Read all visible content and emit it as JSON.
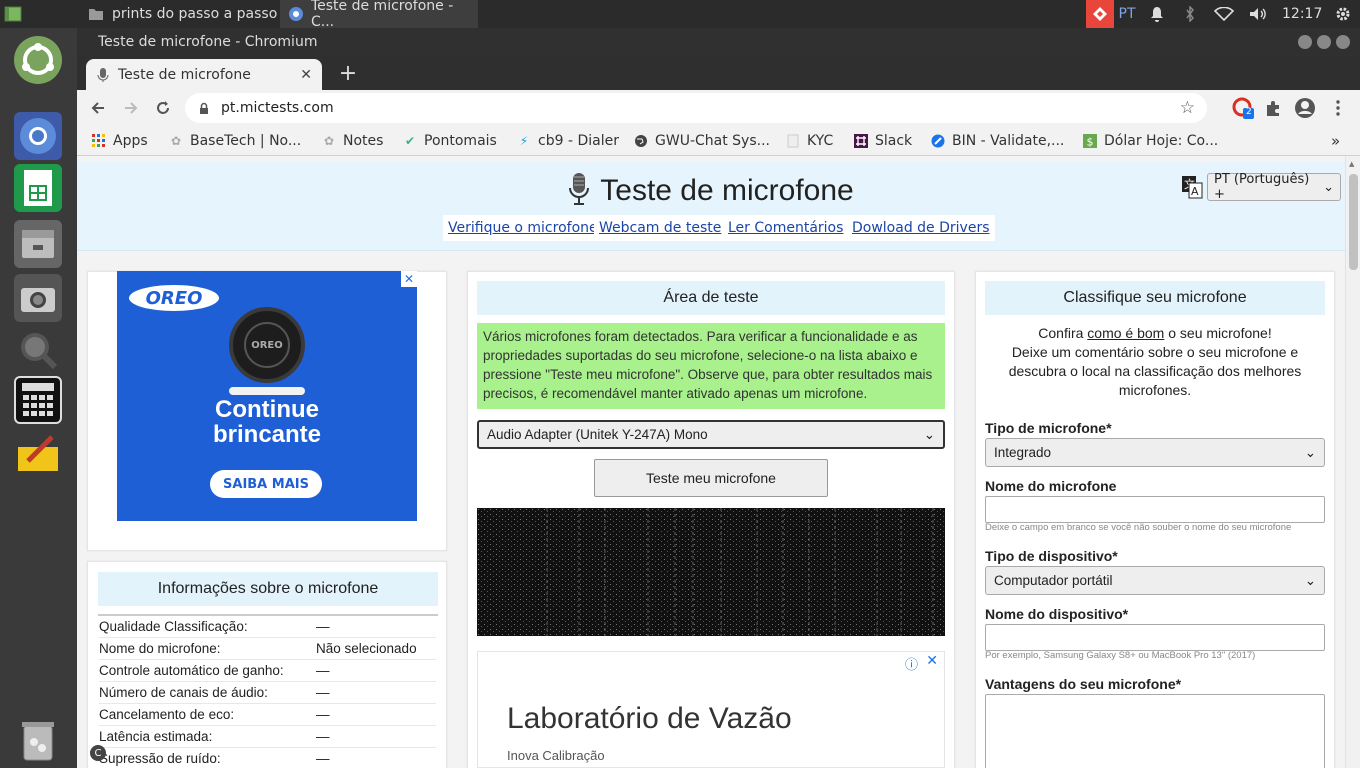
{
  "system_bar": {
    "taskbar_items": [
      "prints do passo a passo",
      "Teste de microfone - C..."
    ],
    "indicator_text": "PT",
    "clock": "12:17"
  },
  "launcher": {
    "apps": [
      "ubuntu-icon",
      "chromium-icon",
      "spreadsheet-icon",
      "files-icon",
      "camera-icon",
      "magnifier-icon",
      "calculator-icon",
      "notes-icon",
      "trash-icon"
    ]
  },
  "window": {
    "title": "Teste de microfone - Chromium",
    "tab_title": "Teste de microfone",
    "url": "pt.mictests.com"
  },
  "bookmarks": [
    "Apps",
    "BaseTech | No...",
    "Notes",
    "Pontomais",
    "cb9 - Dialer",
    "GWU-Chat Sys...",
    "KYC",
    "Slack",
    "BIN - Validate,...",
    "Dólar Hoje: Co..."
  ],
  "extension_badge": "2",
  "site": {
    "title": "Teste de microfone",
    "nav": [
      "Verifique o microfone",
      "Webcam de teste",
      "Ler Comentários",
      "Dowload de Drivers"
    ],
    "language": "PT (Português) +"
  },
  "ad_oreo": {
    "brand": "OREO",
    "cookie_text": "OREO",
    "headline_1": "Continue",
    "headline_2": "brincante",
    "cta": "SAIBA MAIS"
  },
  "info": {
    "heading": "Informações sobre o microfone",
    "rows": [
      {
        "key": "Qualidade Classificação:",
        "value": "—"
      },
      {
        "key": "Nome do microfone:",
        "value": "Não selecionado"
      },
      {
        "key": "Controle automático de ganho:",
        "value": "—"
      },
      {
        "key": "Número de canais de áudio:",
        "value": "—"
      },
      {
        "key": "Cancelamento de eco:",
        "value": "—"
      },
      {
        "key": "Latência estimada:",
        "value": "—"
      },
      {
        "key": "Supressão de ruído:",
        "value": "—"
      }
    ]
  },
  "test_area": {
    "heading": "Área de teste",
    "notice": "Vários microfones foram detectados. Para verificar a funcionalidade e as propriedades suportadas do seu microfone, selecione-o na lista abaixo e pressione \"Teste meu microfone\". Observe que, para obter resultados mais precisos, é recomendável manter ativado apenas um microfone.",
    "selected_mic": "Audio Adapter (Unitek Y-247A) Mono",
    "button": "Teste meu microfone"
  },
  "ad_lab": {
    "title": "Laboratório de Vazão",
    "subtitle": "Inova Calibração"
  },
  "rating": {
    "heading": "Classifique seu microfone",
    "intro_1": "Confira ",
    "intro_link": "como é bom",
    "intro_2": " o seu microfone!",
    "intro_3": "Deixe um comentário sobre o seu microfone e descubra o local na classificação dos melhores microfones.",
    "mic_type_label": "Tipo de microfone*",
    "mic_type_value": "Integrado",
    "mic_name_label": "Nome do microfone",
    "mic_name_hint": "Deixe o campo em branco se você não souber o nome do seu microfone",
    "device_type_label": "Tipo de dispositivo*",
    "device_type_value": "Computador portátil",
    "device_name_label": "Nome do dispositivo*",
    "device_name_hint": "Por exemplo, Samsung Galaxy S8+ ou MacBook Pro 13\" (2017)",
    "advantages_label": "Vantagens do seu microfone*"
  }
}
